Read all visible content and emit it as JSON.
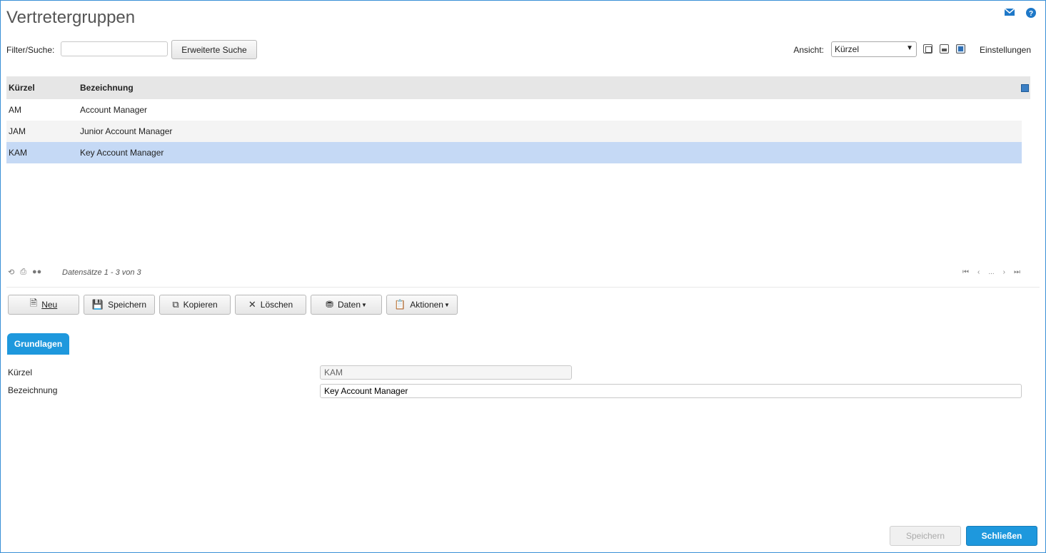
{
  "page": {
    "title": "Vertretergruppen"
  },
  "top_icons": [
    "mail-icon",
    "help-icon"
  ],
  "toolbar": {
    "filter_label": "Filter/Suche:",
    "filter_value": "",
    "extended_search_label": "Erweiterte Suche",
    "view_label": "Ansicht:",
    "view_selected": "Kürzel",
    "settings_label": "Einstellungen"
  },
  "grid": {
    "columns": [
      "Kürzel",
      "Bezeichnung"
    ],
    "rows": [
      {
        "code": "AM",
        "name": "Account Manager"
      },
      {
        "code": "JAM",
        "name": "Junior Account Manager"
      },
      {
        "code": "KAM",
        "name": "Key Account Manager"
      }
    ],
    "selected_row": 2,
    "footer_text": "Datensätze 1 - 3 von 3",
    "pager": [
      "⏮",
      "‹",
      "...",
      "›",
      "⏭"
    ]
  },
  "actions": {
    "new": "Neu",
    "save": "Speichern",
    "copy": "Kopieren",
    "delete": "Löschen",
    "data": "Daten",
    "actions": "Aktionen"
  },
  "tab": {
    "label": "Grundlagen"
  },
  "form": {
    "code_label": "Kürzel",
    "code_value": "KAM",
    "name_label": "Bezeichnung",
    "name_value": "Key Account Manager"
  },
  "footer": {
    "save_label": "Speichern",
    "close_label": "Schließen"
  },
  "colors": {
    "accent": "#1e98dd",
    "selection": "#c5d9f5",
    "header": "#e6e6e6"
  }
}
